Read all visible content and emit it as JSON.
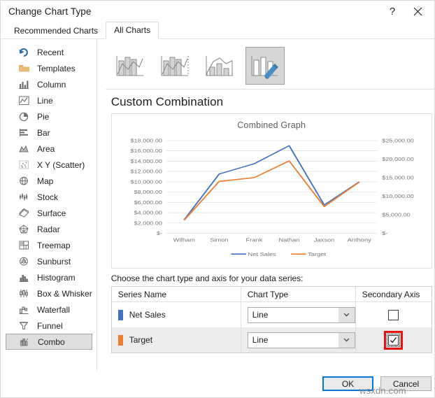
{
  "window": {
    "title": "Change Chart Type",
    "help_icon": "question-mark-icon",
    "close_icon": "close-icon"
  },
  "tabs": [
    {
      "label": "Recommended Charts",
      "active": false
    },
    {
      "label": "All Charts",
      "active": true
    }
  ],
  "sidebar": {
    "items": [
      {
        "label": "Recent",
        "icon": "recent-undo-icon",
        "selected": false
      },
      {
        "label": "Templates",
        "icon": "folder-icon",
        "selected": false
      },
      {
        "label": "Column",
        "icon": "column-chart-icon",
        "selected": false
      },
      {
        "label": "Line",
        "icon": "line-chart-icon",
        "selected": false
      },
      {
        "label": "Pie",
        "icon": "pie-chart-icon",
        "selected": false
      },
      {
        "label": "Bar",
        "icon": "bar-chart-icon",
        "selected": false
      },
      {
        "label": "Area",
        "icon": "area-chart-icon",
        "selected": false
      },
      {
        "label": "X Y (Scatter)",
        "icon": "scatter-chart-icon",
        "selected": false
      },
      {
        "label": "Map",
        "icon": "map-globe-icon",
        "selected": false
      },
      {
        "label": "Stock",
        "icon": "stock-chart-icon",
        "selected": false
      },
      {
        "label": "Surface",
        "icon": "surface-chart-icon",
        "selected": false
      },
      {
        "label": "Radar",
        "icon": "radar-chart-icon",
        "selected": false
      },
      {
        "label": "Treemap",
        "icon": "treemap-icon",
        "selected": false
      },
      {
        "label": "Sunburst",
        "icon": "sunburst-icon",
        "selected": false
      },
      {
        "label": "Histogram",
        "icon": "histogram-icon",
        "selected": false
      },
      {
        "label": "Box & Whisker",
        "icon": "box-whisker-icon",
        "selected": false
      },
      {
        "label": "Waterfall",
        "icon": "waterfall-icon",
        "selected": false
      },
      {
        "label": "Funnel",
        "icon": "funnel-icon",
        "selected": false
      },
      {
        "label": "Combo",
        "icon": "combo-chart-icon",
        "selected": true
      }
    ]
  },
  "thumbnails": [
    {
      "name": "clustered-column-line",
      "selected": false
    },
    {
      "name": "clustered-column-line-on-secondary-axis",
      "selected": false
    },
    {
      "name": "stacked-area-clustered-column",
      "selected": false
    },
    {
      "name": "custom-combination",
      "selected": true
    }
  ],
  "heading": "Custom Combination",
  "table": {
    "instruction": "Choose the chart type and axis for your data series:",
    "headers": [
      "Series Name",
      "Chart Type",
      "Secondary Axis"
    ],
    "rows": [
      {
        "series": "Net Sales",
        "color": "#4472c4",
        "chart_type": "Line",
        "secondary_axis": false,
        "highlighted": false
      },
      {
        "series": "Target",
        "color": "#ed7d31",
        "chart_type": "Line",
        "secondary_axis": true,
        "highlighted": true
      }
    ]
  },
  "footer": {
    "ok_label": "OK",
    "cancel_label": "Cancel",
    "watermark": "wsxdn.com"
  },
  "chart_data": {
    "type": "line",
    "title": "Combined Graph",
    "categories": [
      "Wilham",
      "Simon",
      "Frank",
      "Nathan",
      "Jaxson",
      "Anthony"
    ],
    "series": [
      {
        "name": "Net Sales",
        "color": "#4472c4",
        "axis": "primary",
        "values": [
          2600,
          11500,
          13500,
          17000,
          5500,
          10000
        ]
      },
      {
        "name": "Target",
        "color": "#ed7d31",
        "axis": "secondary",
        "values": [
          3500,
          14000,
          15000,
          19500,
          7200,
          13800
        ]
      }
    ],
    "primary_axis": {
      "ticks": [
        "$-",
        "$2,000.00",
        "$4,000.00",
        "$6,000.00",
        "$8,000.00",
        "$10,000.00",
        "$12,000.00",
        "$14,000.00",
        "$16,000.00",
        "$18,000.00"
      ],
      "min": 0,
      "max": 18000,
      "step": 2000
    },
    "secondary_axis": {
      "ticks": [
        "$-",
        "$5,000.00",
        "$10,000.00",
        "$15,000.00",
        "$20,000.00",
        "$25,000.00"
      ],
      "min": 0,
      "max": 25000,
      "step": 5000
    },
    "legend": [
      "Net Sales",
      "Target"
    ],
    "legend_position": "bottom",
    "grid": true
  }
}
